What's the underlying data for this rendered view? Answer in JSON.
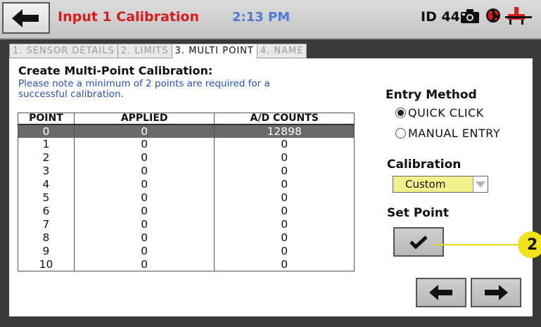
{
  "header": {
    "title": "Input 1 Calibration",
    "time": "2:13 PM",
    "device_id": "ID 44"
  },
  "tabs": [
    {
      "label": "1. SENSOR DETAILS",
      "active": false
    },
    {
      "label": "2. LIMITS",
      "active": false
    },
    {
      "label": "3. MULTI POINT",
      "active": true
    },
    {
      "label": "4. NAME",
      "active": false
    }
  ],
  "panel": {
    "heading": "Create Multi-Point Calibration:",
    "note_line1": "Please note a minimum of 2 points are required for a",
    "note_line2": "successful calibration."
  },
  "table": {
    "headers": [
      "POINT",
      "APPLIED",
      "A/D COUNTS"
    ],
    "rows": [
      {
        "point": "0",
        "applied": "0",
        "ad_counts": "12898"
      },
      {
        "point": "1",
        "applied": "0",
        "ad_counts": "0"
      },
      {
        "point": "2",
        "applied": "0",
        "ad_counts": "0"
      },
      {
        "point": "3",
        "applied": "0",
        "ad_counts": "0"
      },
      {
        "point": "4",
        "applied": "0",
        "ad_counts": "0"
      },
      {
        "point": "5",
        "applied": "0",
        "ad_counts": "0"
      },
      {
        "point": "6",
        "applied": "0",
        "ad_counts": "0"
      },
      {
        "point": "7",
        "applied": "0",
        "ad_counts": "0"
      },
      {
        "point": "8",
        "applied": "0",
        "ad_counts": "0"
      },
      {
        "point": "9",
        "applied": "0",
        "ad_counts": "0"
      },
      {
        "point": "10",
        "applied": "0",
        "ad_counts": "0"
      }
    ],
    "selected_row": 0
  },
  "entry_method": {
    "label": "Entry Method",
    "options": [
      "QUICK CLICK",
      "MANUAL ENTRY"
    ],
    "selected": "QUICK CLICK"
  },
  "calibration": {
    "label": "Calibration",
    "value": "Custom"
  },
  "set_point": {
    "label": "Set Point"
  },
  "callout": {
    "number": "2"
  },
  "icons": {
    "back": "arrow-left-icon",
    "camera": "camera-icon",
    "globe": "globe-icon",
    "sensor": "sensor-icon",
    "checkmark": "checkmark-icon",
    "prev": "arrow-left-icon",
    "next": "arrow-right-icon",
    "dropdown": "triangle-down-icon"
  },
  "colors": {
    "title_red": "#d81b1b",
    "time_blue": "#4e7ad8",
    "note_blue": "#2a50c0",
    "selected_row": "#6a6a6a",
    "dropdown_yellow": "#f2f28a",
    "callout_yellow": "#f3e21a"
  }
}
